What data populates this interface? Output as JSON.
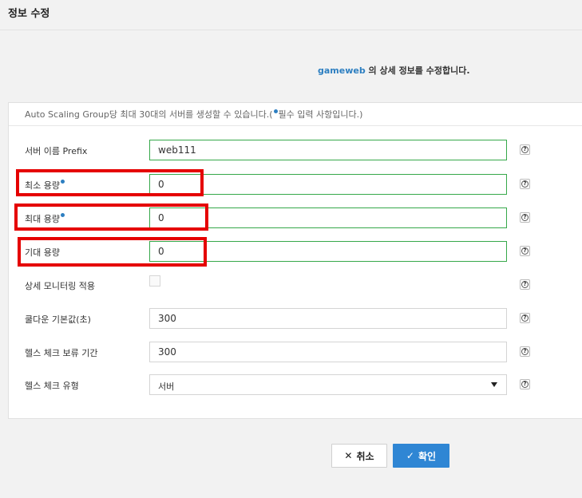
{
  "header": {
    "title": "정보 수정"
  },
  "subtitle": {
    "app_name": "gameweb",
    "text": " 의 상세 정보를 수정합니다."
  },
  "notice": {
    "text_before": "Auto Scaling Group당 최대 30대의 서버를 생성할 수 있습니다.(",
    "text_after": "필수 입력 사항입니다.)"
  },
  "form": {
    "server_prefix": {
      "label": "서버 이름 Prefix",
      "value": "web111"
    },
    "min_capacity": {
      "label": "최소 용량",
      "value": "0",
      "required": true
    },
    "max_capacity": {
      "label": "최대 용량",
      "value": "0",
      "required": true
    },
    "desired_capacity": {
      "label": "기대 용량",
      "value": "0"
    },
    "detailed_monitoring": {
      "label": "상세 모니터링 적용",
      "checked": false
    },
    "cooldown": {
      "label": "쿨다운 기본값(초)",
      "value": "300"
    },
    "health_grace": {
      "label": "헬스 체크 보류 기간",
      "value": "300"
    },
    "health_type": {
      "label": "헬스 체크 유형",
      "selected": "서버"
    },
    "help_symbol": "?"
  },
  "buttons": {
    "cancel": {
      "label": "취소",
      "icon": "close-icon"
    },
    "confirm": {
      "label": "확인",
      "icon": "check-icon"
    }
  },
  "colors": {
    "accent": "#2f86d4",
    "highlight": "#e50000",
    "valid_border": "#36a84a"
  }
}
